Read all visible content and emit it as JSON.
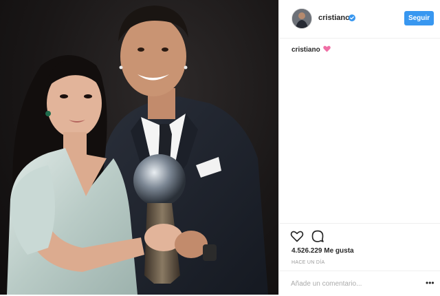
{
  "post": {
    "image_alt": "photo",
    "author": {
      "username": "cristiano",
      "verified": true,
      "avatar": "avatar-photo"
    },
    "follow_label": "Seguir",
    "caption": {
      "username": "cristiano",
      "emoji": "heart-emoji"
    },
    "likes_text": "4.526.229 Me gusta",
    "timestamp": "HACE UN DÍA",
    "comment_placeholder": "Añade un comentario...",
    "more_icon": "more-dots-icon"
  },
  "colors": {
    "accent": "#3897f0",
    "heart": "#ed4956",
    "text": "#262626",
    "muted": "#999999",
    "border": "#efefef"
  }
}
